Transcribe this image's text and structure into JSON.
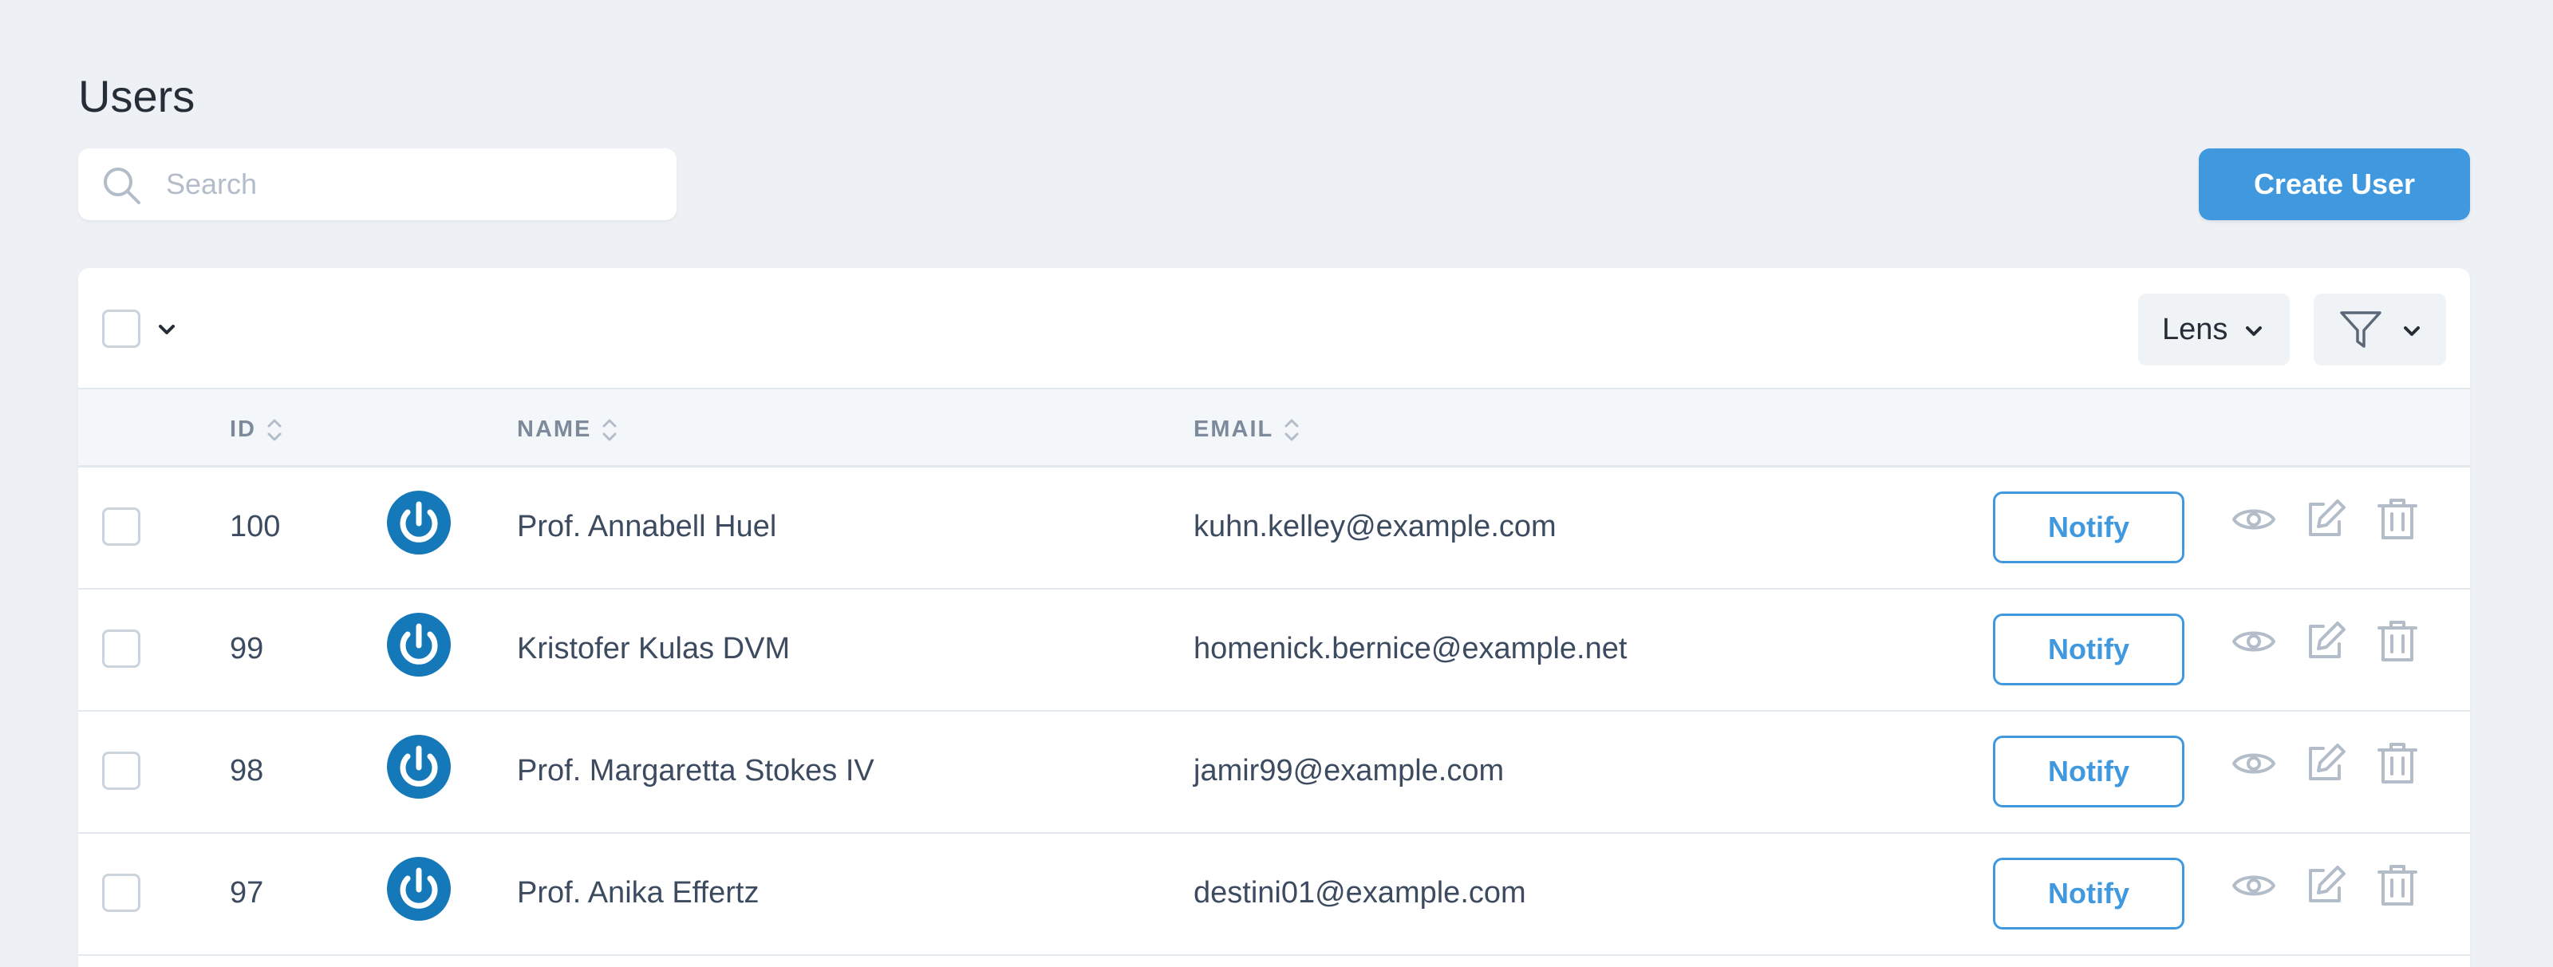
{
  "page": {
    "title": "Users"
  },
  "search": {
    "placeholder": "Search",
    "value": ""
  },
  "actions": {
    "create_label": "Create User"
  },
  "toolbar": {
    "lens_label": "Lens"
  },
  "table": {
    "columns": {
      "id": "ID",
      "name": "NAME",
      "email": "EMAIL"
    },
    "rows": [
      {
        "id": "100",
        "name": "Prof. Annabell Huel",
        "email": "kuhn.kelley@example.com",
        "notify": "Notify"
      },
      {
        "id": "99",
        "name": "Kristofer Kulas DVM",
        "email": "homenick.bernice@example.net",
        "notify": "Notify"
      },
      {
        "id": "98",
        "name": "Prof. Margaretta Stokes IV",
        "email": "jamir99@example.com",
        "notify": "Notify"
      },
      {
        "id": "97",
        "name": "Prof. Anika Effertz",
        "email": "destini01@example.com",
        "notify": "Notify"
      }
    ]
  },
  "colors": {
    "accent": "#4099de",
    "avatar": "#1578b8",
    "background": "#edf1f5",
    "icon": "#b3bdc9"
  },
  "icons": {
    "search": "search-icon",
    "view": "eye-icon",
    "edit": "edit-icon",
    "delete": "trash-icon",
    "filter": "filter-icon",
    "avatar": "power-icon"
  }
}
